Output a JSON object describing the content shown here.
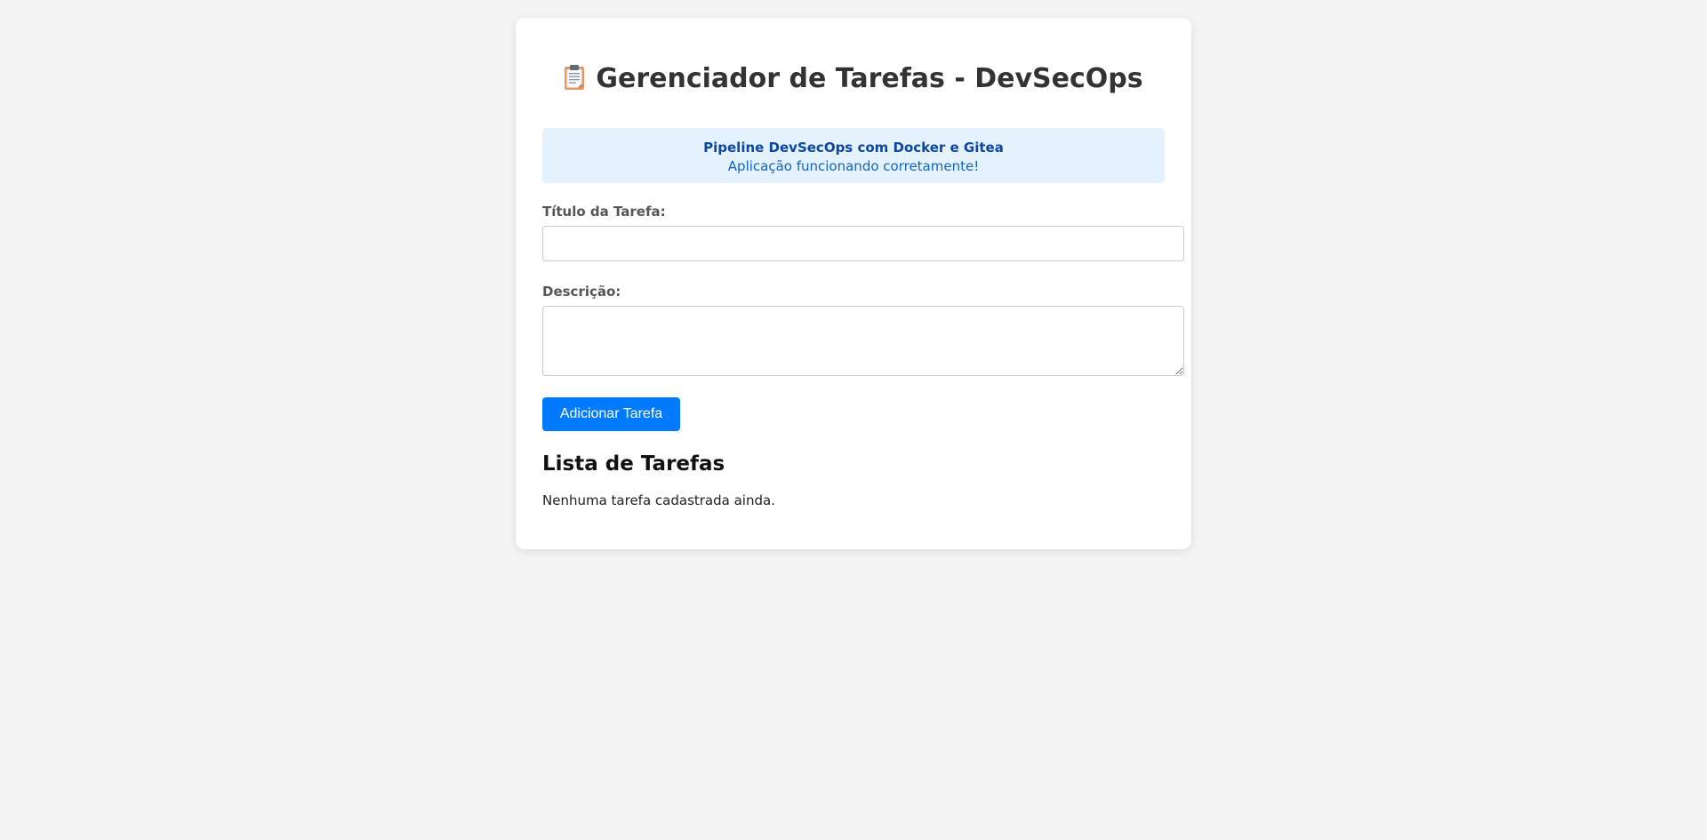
{
  "app": {
    "title": "Gerenciador de Tarefas - DevSecOps",
    "title_icon": "clipboard-icon"
  },
  "banner": {
    "strong": "Pipeline DevSecOps com Docker e Gitea",
    "text": "Aplicação funcionando corretamente!"
  },
  "form": {
    "title_label": "Título da Tarefa:",
    "title_value": "",
    "description_label": "Descrição:",
    "description_value": "",
    "submit_label": "Adicionar Tarefa"
  },
  "tasks": {
    "heading": "Lista de Tarefas",
    "empty_message": "Nenhuma tarefa cadastrada ainda."
  },
  "colors": {
    "page_background": "#f4f4f4",
    "banner_background": "#e3f2fd",
    "banner_text": "#1565c0",
    "button_background": "#007bff"
  }
}
